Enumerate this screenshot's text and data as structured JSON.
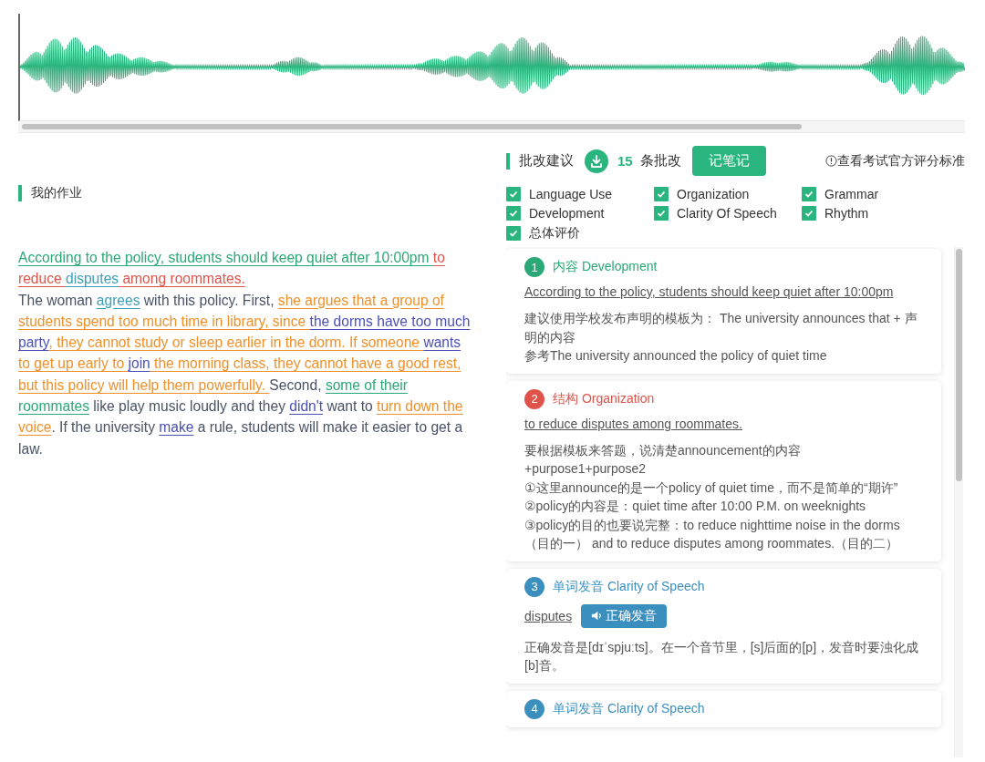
{
  "homework": {
    "title": "我的作业",
    "paragraphs": [
      [
        {
          "text": "According to the policy, students should keep quiet after 10:00pm ",
          "color": "#2aa876"
        },
        {
          "text": "to reduce ",
          "color": "#e0534a"
        },
        {
          "text": "disputes",
          "color": "#3a9fb8"
        },
        {
          "text": " among roommates.",
          "color": "#e0534a"
        }
      ],
      [
        {
          "text": "The woman "
        },
        {
          "text": "agrees",
          "color": "#3a9fb8"
        },
        {
          "text": " with this policy. First, "
        },
        {
          "text": "she argues that a group of students spend too much time in library, since ",
          "color": "#f0902a"
        },
        {
          "text": "the dorms have too much party",
          "color": "#4a50b8"
        },
        {
          "text": ", they cannot study or sleep earlier in the dorm. If someone ",
          "color": "#f0902a"
        },
        {
          "text": "wants ",
          "color": "#4a50b8"
        },
        {
          "text": "to get up early to ",
          "color": "#f0902a"
        },
        {
          "text": "join",
          "color": "#4a50b8"
        },
        {
          "text": " the morning class, they cannot have a good rest, but this policy will help them powerfully. ",
          "color": "#f0902a"
        },
        {
          "text": "Second, "
        },
        {
          "text": "some of their roommates",
          "color": "#2aa876"
        },
        {
          "text": " like play music loudly and they "
        },
        {
          "text": "didn't",
          "color": "#4a50b8"
        },
        {
          "text": " want to "
        },
        {
          "text": "turn down the voice",
          "color": "#f0902a"
        },
        {
          "text": ". If the university "
        },
        {
          "text": "make",
          "color": "#4a50b8"
        },
        {
          "text": " a rule, students will make it easier to get a law."
        }
      ]
    ]
  },
  "review": {
    "title": "批改建议",
    "count": "15",
    "count_label": "条批改",
    "note_button": "记笔记",
    "standard_link": "查看考试官方评分标准",
    "filters": [
      {
        "label": "Language Use",
        "checked": true
      },
      {
        "label": "Organization",
        "checked": true
      },
      {
        "label": "Grammar",
        "checked": true
      },
      {
        "label": "Development",
        "checked": true
      },
      {
        "label": "Clarity Of Speech",
        "checked": true
      },
      {
        "label": "Rhythm",
        "checked": true
      },
      {
        "label": "总体评价",
        "checked": true
      }
    ],
    "cards": [
      {
        "number": "1",
        "title": "内容 Development",
        "color": "#2aa876",
        "quote": "According to the policy, students should keep quiet after 10:00pm",
        "lines": [
          "建议使用学校发布声明的模板为：  The university announces that + 声明的内容",
          "参考The university announced the policy of quiet time"
        ]
      },
      {
        "number": "2",
        "title": "结构 Organization",
        "color": "#e0534a",
        "quote": "to reduce disputes among roommates.",
        "lines": [
          "要根据模板来答题，说清楚announcement的内容 +purpose1+purpose2",
          "①这里announce的是一个policy of quiet time，而不是简单的“期许”",
          "②policy的内容是：quiet time after 10:00 P.M. on weeknights",
          "③policy的目的也要说完整：to reduce nighttime noise in the dorms （目的一） and to reduce disputes among roommates.（目的二）"
        ]
      },
      {
        "number": "3",
        "title": "单词发音 Clarity of Speech",
        "color": "#3a8fbf",
        "quote": "disputes",
        "button": "正确发音",
        "lines": [
          "正确发音是[dɪˈspjuːts]。在一个音节里，[s]后面的[p]，发音时要浊化成[b]音。"
        ]
      },
      {
        "number": "4",
        "title": "单词发音 Clarity of Speech",
        "color": "#3a8fbf"
      }
    ]
  }
}
